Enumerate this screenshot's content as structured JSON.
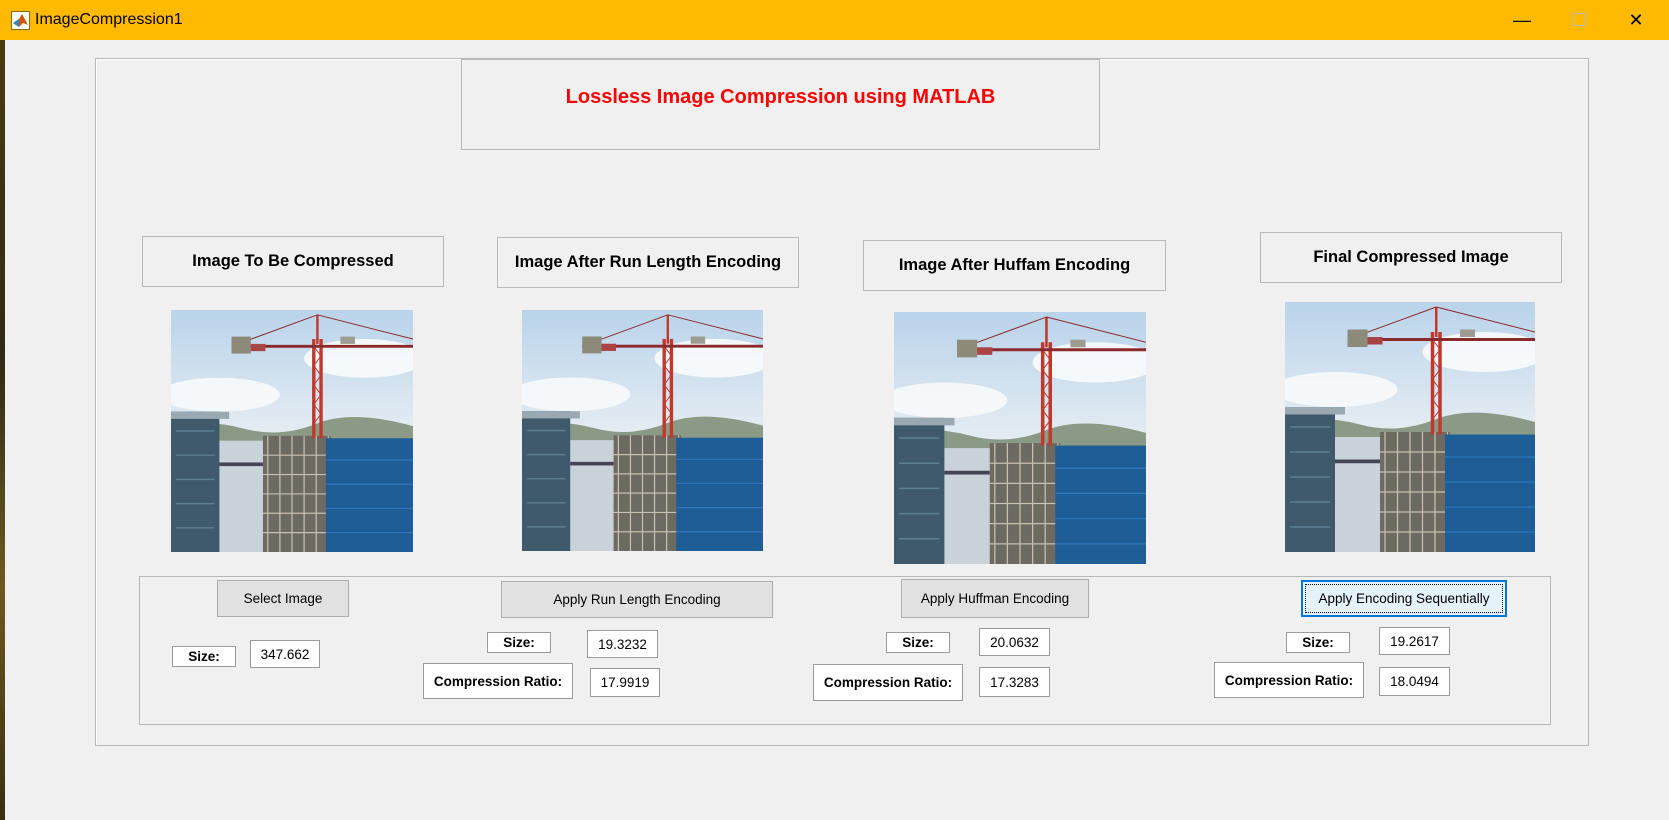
{
  "window": {
    "title": "ImageCompression1",
    "app_icon": "matlab-icon",
    "controls": {
      "minimize": "—",
      "maximize": "☐",
      "close": "✕"
    }
  },
  "heading": "Lossless Image Compression using MATLAB",
  "colors": {
    "titlebar": "#ffba00",
    "heading": "#ff0000",
    "panel": "#f0f0f0",
    "focus": "#0078d7"
  },
  "sections": [
    {
      "label": "Image To Be Compressed",
      "image": "construction-crane-photo"
    },
    {
      "label": "Image After Run Length Encoding",
      "image": "construction-crane-photo"
    },
    {
      "label": "Image After Huffam Encoding",
      "image": "construction-crane-photo"
    },
    {
      "label": "Final Compressed Image",
      "image": "construction-crane-photo"
    }
  ],
  "controls": {
    "select_image": {
      "label": "Select Image",
      "size_label": "Size:",
      "size_value": "347.662"
    },
    "rle": {
      "label": "Apply Run Length Encoding",
      "size_label": "Size:",
      "size_value": "19.3232",
      "ratio_label": "Compression Ratio:",
      "ratio_value": "17.9919"
    },
    "huffman": {
      "label": "Apply Huffman Encoding",
      "size_label": "Size:",
      "size_value": "20.0632",
      "ratio_label": "Compression Ratio:",
      "ratio_value": "17.3283"
    },
    "sequential": {
      "label": "Apply Encoding Sequentially",
      "size_label": "Size:",
      "size_value": "19.2617",
      "ratio_label": "Compression Ratio:",
      "ratio_value": "18.0494"
    }
  }
}
